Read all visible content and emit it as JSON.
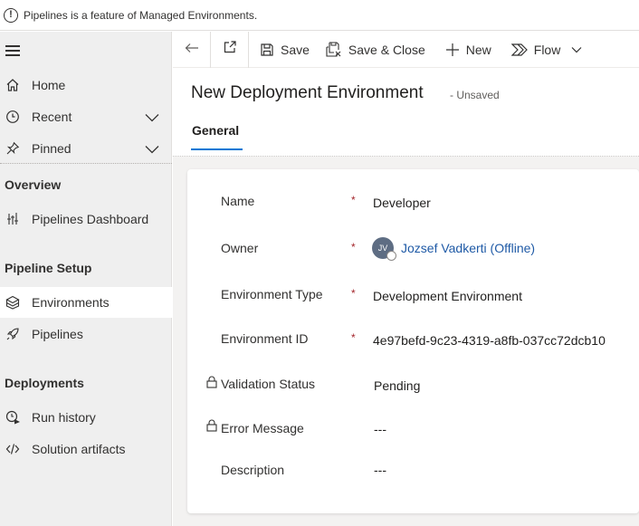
{
  "notification": {
    "icon": "info-icon",
    "glyph": "!",
    "text": "Pipelines is a feature of Managed Environments."
  },
  "sidebar": {
    "top_items": [
      {
        "label": "Home",
        "icon": "home-icon"
      },
      {
        "label": "Recent",
        "icon": "clock-icon"
      },
      {
        "label": "Pinned",
        "icon": "pin-icon"
      }
    ],
    "sections": [
      {
        "title": "Overview",
        "items": [
          {
            "label": "Pipelines Dashboard",
            "icon": "dashboard-icon"
          }
        ]
      },
      {
        "title": "Pipeline Setup",
        "items": [
          {
            "label": "Environments",
            "icon": "environment-icon",
            "selected": true
          },
          {
            "label": "Pipelines",
            "icon": "rocket-icon"
          }
        ]
      },
      {
        "title": "Deployments",
        "items": [
          {
            "label": "Run history",
            "icon": "run-history-icon"
          },
          {
            "label": "Solution artifacts",
            "icon": "code-icon"
          }
        ]
      }
    ]
  },
  "commandbar": {
    "save": "Save",
    "save_close": "Save & Close",
    "new": "New",
    "flow": "Flow"
  },
  "form": {
    "title": "New Deployment Environment",
    "status": "- Unsaved",
    "tab": "General",
    "fields": {
      "name": {
        "label": "Name",
        "required": "*",
        "value": "Developer"
      },
      "owner": {
        "label": "Owner",
        "required": "*",
        "initials": "JV",
        "value": "Jozsef Vadkerti (Offline)"
      },
      "env_type": {
        "label": "Environment Type",
        "required": "*",
        "value": "Development Environment"
      },
      "env_id": {
        "label": "Environment ID",
        "required": "*",
        "value": "4e97befd-9c23-4319-a8fb-037cc72dcb10"
      },
      "validation": {
        "label": "Validation Status",
        "value": "Pending"
      },
      "error": {
        "label": "Error Message",
        "value": "---"
      },
      "description": {
        "label": "Description",
        "value": "---"
      }
    }
  },
  "colors": {
    "accent": "#0078d4",
    "required": "#a4262c",
    "link": "#1f5aa6",
    "sidebar_bg": "#efefef"
  }
}
